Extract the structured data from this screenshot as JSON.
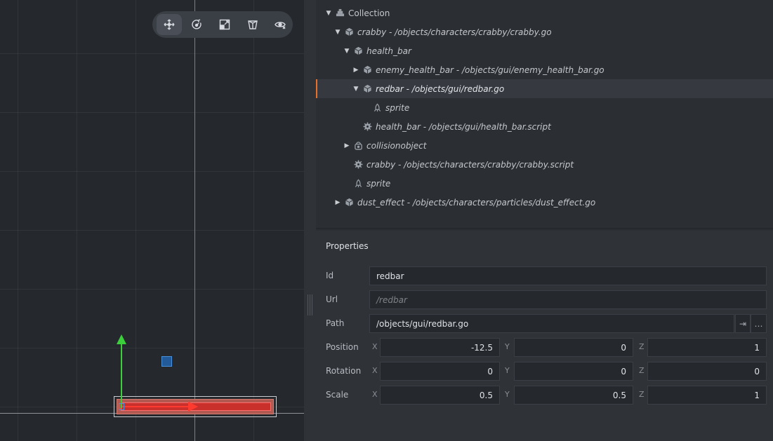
{
  "toolbar": {
    "tools": [
      {
        "icon": "move-tool-icon",
        "active": true
      },
      {
        "icon": "rotate-tool-icon",
        "active": false
      },
      {
        "icon": "scale-tool-icon",
        "active": false
      },
      {
        "icon": "perspective-camera-icon",
        "active": false
      },
      {
        "icon": "visibility-filter-icon",
        "active": false
      }
    ]
  },
  "outline": {
    "items": [
      {
        "label": "Collection",
        "icon": "collection-icon",
        "arrow": "down",
        "italic": false
      },
      {
        "label": "crabby - /objects/characters/crabby/crabby.go",
        "icon": "game-object-icon",
        "arrow": "down",
        "italic": true
      },
      {
        "label": "health_bar",
        "icon": "game-object-icon",
        "arrow": "down",
        "italic": true
      },
      {
        "label": "enemy_health_bar - /objects/gui/enemy_health_bar.go",
        "icon": "game-object-icon",
        "arrow": "right",
        "italic": true
      },
      {
        "label": "redbar - /objects/gui/redbar.go",
        "icon": "game-object-icon",
        "arrow": "down",
        "italic": true,
        "selected": true
      },
      {
        "label": "sprite",
        "icon": "sprite-icon",
        "arrow": "none",
        "italic": true
      },
      {
        "label": "health_bar - /objects/gui/health_bar.script",
        "icon": "script-gear-icon",
        "arrow": "none",
        "italic": true
      },
      {
        "label": "collisionobject",
        "icon": "collision-object-icon",
        "arrow": "right",
        "italic": true
      },
      {
        "label": "crabby - /objects/characters/crabby/crabby.script",
        "icon": "script-gear-icon",
        "arrow": "none",
        "italic": true
      },
      {
        "label": "sprite",
        "icon": "sprite-icon",
        "arrow": "none",
        "italic": true
      },
      {
        "label": "dust_effect - /objects/characters/particles/dust_effect.go",
        "icon": "game-object-icon",
        "arrow": "right",
        "italic": true
      }
    ]
  },
  "properties": {
    "title": "Properties",
    "id_label": "Id",
    "id_value": "redbar",
    "url_label": "Url",
    "url_placeholder": "/redbar",
    "path_label": "Path",
    "path_value": "/objects/gui/redbar.go",
    "path_goto": "⇥",
    "path_more": "…",
    "position": {
      "label": "Position",
      "x": "-12.5",
      "y": "0",
      "z": "1"
    },
    "rotation": {
      "label": "Rotation",
      "x": "0",
      "y": "0",
      "z": "0"
    },
    "scale": {
      "label": "Scale",
      "x": "0.5",
      "y": "0.5",
      "z": "1"
    },
    "axis_x": "X",
    "axis_y": "Y",
    "axis_z": "Z"
  },
  "colors": {
    "accent_selection": "#e8702a",
    "gizmo_x": "#ff3b30",
    "gizmo_y": "#3ccf3c",
    "gizmo_plane": "#235a9a"
  }
}
